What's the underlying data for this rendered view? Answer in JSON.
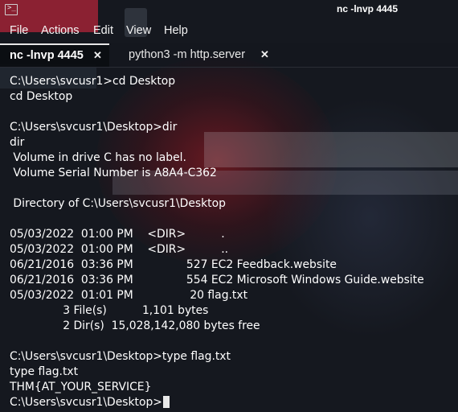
{
  "window": {
    "title": "nc -lnvp 4445"
  },
  "menu": [
    "File",
    "Actions",
    "Edit",
    "View",
    "Help"
  ],
  "tabs": [
    {
      "label": "nc -lnvp 4445",
      "active": true,
      "close": "✕"
    },
    {
      "label": "python3 -m http.server",
      "active": false,
      "close": "✕"
    }
  ],
  "terminal": {
    "lines": [
      "C:\\Users\\svcusr1>cd Desktop",
      "cd Desktop",
      "",
      "C:\\Users\\svcusr1\\Desktop>dir",
      "dir",
      " Volume in drive C has no label.",
      " Volume Serial Number is A8A4-C362",
      "",
      " Directory of C:\\Users\\svcusr1\\Desktop",
      "",
      "05/03/2022  01:00 PM    <DIR>          .",
      "05/03/2022  01:00 PM    <DIR>          ..",
      "06/21/2016  03:36 PM               527 EC2 Feedback.website",
      "06/21/2016  03:36 PM               554 EC2 Microsoft Windows Guide.website",
      "05/03/2022  01:01 PM                20 flag.txt",
      "               3 File(s)          1,101 bytes",
      "               2 Dir(s)  15,028,142,080 bytes free",
      "",
      "C:\\Users\\svcusr1\\Desktop>type flag.txt",
      "type flag.txt",
      "THM{AT_YOUR_SERVICE}",
      "C:\\Users\\svcusr1\\Desktop>"
    ]
  },
  "colors": {
    "background": "#15181f",
    "text": "#ffffff",
    "accent_red": "#b3243a"
  }
}
